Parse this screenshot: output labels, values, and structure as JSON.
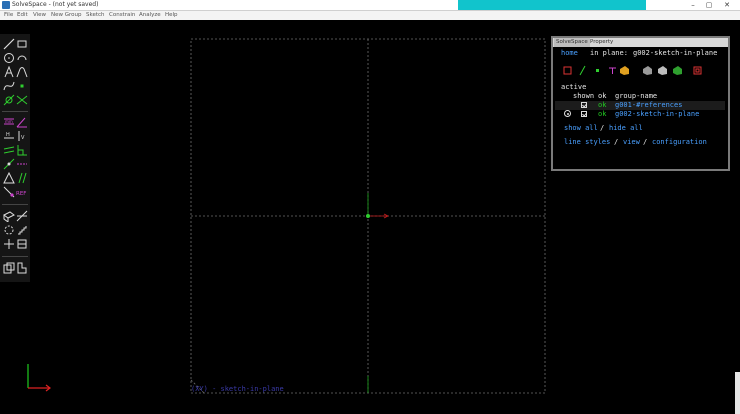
{
  "window": {
    "title": "SolveSpace - (not yet saved)",
    "controls": {
      "minimize": "–",
      "maximize": "▢",
      "close": "✕"
    }
  },
  "menu": {
    "items": [
      "File",
      "Edit",
      "View",
      "New Group",
      "Sketch",
      "Constrain",
      "Analyze",
      "Help"
    ]
  },
  "toolbar": {
    "tools": [
      {
        "icon": "line-icon"
      },
      {
        "icon": "rectangle-icon"
      },
      {
        "icon": "circle-icon"
      },
      {
        "icon": "arc-icon"
      },
      {
        "icon": "text-icon"
      },
      {
        "icon": "tangent-arc-icon"
      },
      {
        "icon": "bezier-icon"
      },
      {
        "icon": "point-icon"
      },
      {
        "icon": "workplane-icon"
      },
      {
        "icon": "split-curves-icon"
      },
      {
        "icon": "distance-dimension-icon"
      },
      {
        "icon": "angle-dimension-icon"
      },
      {
        "icon": "horizontal-constraint-icon"
      },
      {
        "icon": "vertical-constraint-icon"
      },
      {
        "icon": "parallel-constraint-icon"
      },
      {
        "icon": "perpendicular-constraint-icon"
      },
      {
        "icon": "on-entity-constraint-icon"
      },
      {
        "icon": "midpoint-constraint-icon"
      },
      {
        "icon": "symmetric-constraint-icon"
      },
      {
        "icon": "equal-constraint-icon"
      },
      {
        "icon": "construction-toggle-icon"
      },
      {
        "icon": "reference-constraint-icon"
      },
      {
        "icon": "extrude-icon"
      },
      {
        "icon": "lathe-icon"
      },
      {
        "icon": "step-rotate-icon"
      },
      {
        "icon": "step-translate-icon"
      },
      {
        "icon": "workplane-sketch-icon"
      },
      {
        "icon": "assemble-icon"
      },
      {
        "icon": "new-group-icon"
      },
      {
        "icon": "link-icon"
      }
    ],
    "ref_label": "REF"
  },
  "viewport": {
    "workplane_label": "(XY) - sketch-in-plane",
    "colors": {
      "grid": "#6e6e6e",
      "origin_point": "#2fcf2f",
      "x_axis": "#cc2020",
      "y_axis": "#1fa51f"
    }
  },
  "property_browser": {
    "tabs": [
      "SolveSpace",
      "Property"
    ],
    "nav": {
      "home": "home",
      "in_plane": "in plane:",
      "group_name": "g002-sketch-in-plane"
    },
    "active_label": "active",
    "columns": {
      "shown": "shown",
      "ok": "ok",
      "group_name": "group-name"
    },
    "groups": [
      {
        "ok": "ok",
        "name": "g001-#references",
        "shown": true,
        "active": false
      },
      {
        "ok": "ok",
        "name": "g002-sketch-in-plane",
        "shown": true,
        "active": true
      }
    ],
    "show_all": "show all",
    "slash": "/",
    "hide_all": "hide all",
    "line_styles": "line styles",
    "view": "view",
    "configuration": "configuration",
    "colors": {
      "link": "#4aa0ff",
      "text": "#e8e8e8",
      "ok": "#22c822",
      "highlight": "#ffa43a"
    }
  }
}
